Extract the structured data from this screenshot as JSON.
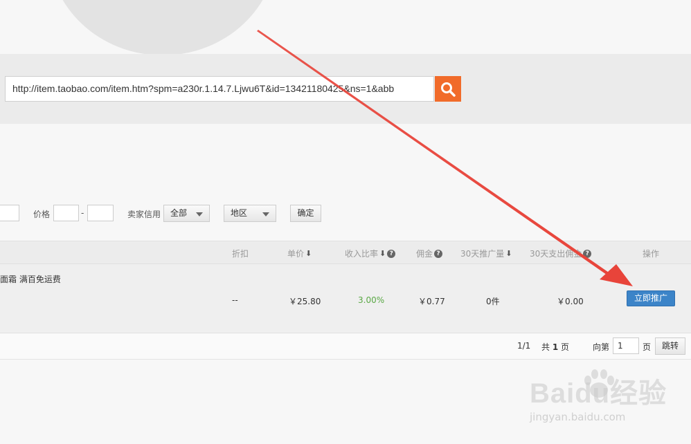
{
  "search": {
    "value": "http://item.taobao.com/item.htm?spm=a230r.1.14.7.Ljwu6T&id=13421180425&ns=1&abb"
  },
  "filters": {
    "price_label": "价格",
    "price_dash": "-",
    "credit_label": "卖家信用",
    "credit_value": "全部",
    "region_value": "地区",
    "confirm_label": "确定"
  },
  "table": {
    "headers": {
      "discount": "折扣",
      "unit_price": "单价",
      "income_ratio": "收入比率",
      "commission": "佣金",
      "promo_30d": "30天推广量",
      "spend_30d": "30天支出佣金",
      "action": "操作"
    },
    "row": {
      "title": "面霜 满百免运费",
      "discount": "--",
      "unit_price": "￥25.80",
      "income_ratio": "3.00%",
      "commission": "￥0.77",
      "promo_30d": "0件",
      "spend_30d": "￥0.00",
      "action_label": "立即推广"
    }
  },
  "pager": {
    "page_of": "1/1",
    "total_prefix": "共",
    "total_pages": "1",
    "total_suffix": "页",
    "goto_prefix": "向第",
    "goto_value": "1",
    "goto_suffix": "页",
    "jump_label": "跳转"
  },
  "watermark": {
    "brand": "Baidu经验",
    "url": "jingyan.baidu.com"
  },
  "colors": {
    "search_button": "#f16b2a",
    "promote_button": "#3c84c8",
    "income_ratio_text": "#5aa845",
    "annotation_arrow": "#e8443a"
  }
}
